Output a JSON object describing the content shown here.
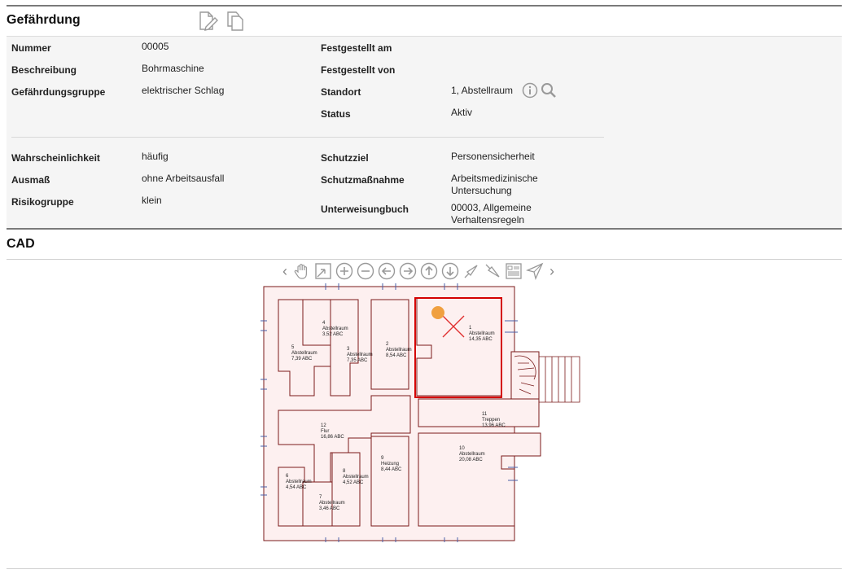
{
  "section_hazard": {
    "title": "Gefährdung"
  },
  "fields_left": [
    {
      "label": "Nummer",
      "value": "00005"
    },
    {
      "label": "Beschreibung",
      "value": "Bohrmaschine"
    },
    {
      "label": "Gefährdungsgruppe",
      "value": "elektrischer Schlag"
    }
  ],
  "fields_right": [
    {
      "label": "Festgestellt am",
      "value": ""
    },
    {
      "label": "Festgestellt von",
      "value": ""
    },
    {
      "label": "Standort",
      "value": "1, Abstellraum"
    },
    {
      "label": "Status",
      "value": "Aktiv"
    }
  ],
  "fields_left2": [
    {
      "label": "Wahrscheinlichkeit",
      "value": "häufig"
    },
    {
      "label": "Ausmaß",
      "value": "ohne Arbeitsausfall"
    },
    {
      "label": "Risikogruppe",
      "value": "klein"
    }
  ],
  "fields_right2": [
    {
      "label": "Schutzziel",
      "value": "Personensicherheit"
    },
    {
      "label": "Schutzmaßnahme",
      "value_line1": "Arbeitsmedizinische",
      "value_line2": "Untersuchung"
    },
    {
      "label": "Unterweisungbuch",
      "value_line1": "00003, Allgemeine",
      "value_line2": "Verhaltensregeln"
    }
  ],
  "section_cad": {
    "title": "CAD"
  },
  "cad_toolbar": {
    "prev": "‹",
    "next": "›"
  },
  "rooms": [
    {
      "num": "1",
      "name": "Abstellraum",
      "area": "14,35 ABC"
    },
    {
      "num": "2",
      "name": "Abstellraum",
      "area": "8,54 ABC"
    },
    {
      "num": "3",
      "name": "Abstellraum",
      "area": "7,35 ABC"
    },
    {
      "num": "4",
      "name": "Abstellraum",
      "area": "3,52 ABC"
    },
    {
      "num": "5",
      "name": "Abstellraum",
      "area": "7,39 ABC"
    },
    {
      "num": "6",
      "name": "Abstellraum",
      "area": "4,54 ABC"
    },
    {
      "num": "7",
      "name": "Abstellraum",
      "area": "3,46 ABC"
    },
    {
      "num": "8",
      "name": "Abstellraum",
      "area": "4,52 ABC"
    },
    {
      "num": "9",
      "name": "Heizung",
      "area": "8,44 ABC"
    },
    {
      "num": "10",
      "name": "Abstellraum",
      "area": "20,08 ABC"
    },
    {
      "num": "11",
      "name": "Treppen",
      "area": "13,96 ABC"
    },
    {
      "num": "12",
      "name": "Flur",
      "area": "16,86 ABC"
    }
  ],
  "colors": {
    "plan_line": "#7a1a1a",
    "plan_fill": "#fdf0f0",
    "highlight": "#d40000",
    "marker": "#f0a040"
  }
}
